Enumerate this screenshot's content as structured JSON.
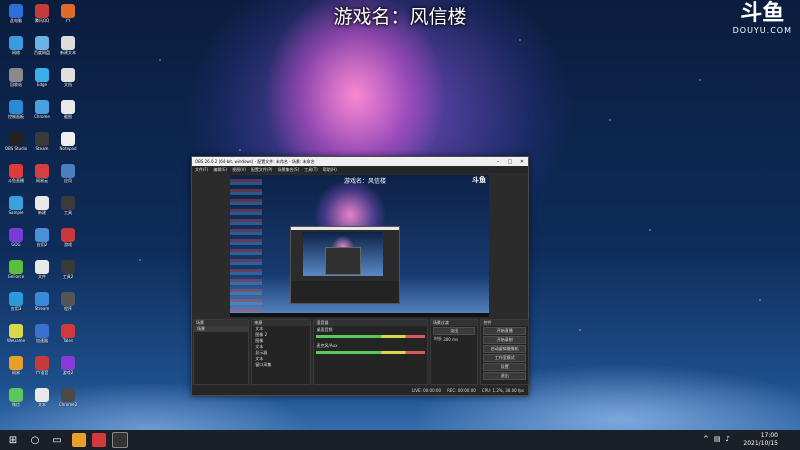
{
  "overlay": {
    "title": "游戏名：风信楼"
  },
  "logo": {
    "cn": "斗鱼",
    "en": "DOUYU.COM"
  },
  "desktop": {
    "icons": [
      {
        "c": "#2d6fd4",
        "label": "此电脑"
      },
      {
        "c": "#c23c3c",
        "label": "腾讯QQ"
      },
      {
        "c": "#e06a2a",
        "label": "YY"
      },
      {
        "c": "#3b9be0",
        "label": "网络"
      },
      {
        "c": "#6bb2e6",
        "label": "百度网盘"
      },
      {
        "c": "#dcdcdc",
        "label": "新建文本"
      },
      {
        "c": "#8a8a8a",
        "label": "回收站"
      },
      {
        "c": "#3bb0e8",
        "label": "Edge"
      },
      {
        "c": "#e0e0e0",
        "label": "文档"
      },
      {
        "c": "#2a8ad8",
        "label": "控制面板"
      },
      {
        "c": "#4aa0e0",
        "label": "Chrome"
      },
      {
        "c": "#e8e8e8",
        "label": "截图"
      },
      {
        "c": "#222",
        "label": "OBS Studio"
      },
      {
        "c": "#3a3a3a",
        "label": "Steam"
      },
      {
        "c": "#f0f0f0",
        "label": "Notepad"
      },
      {
        "c": "#e23a3a",
        "label": "斗鱼直播"
      },
      {
        "c": "#d44040",
        "label": "网易云"
      },
      {
        "c": "#4a80c0",
        "label": "应用"
      },
      {
        "c": "#3aa0e0",
        "label": "Sample"
      },
      {
        "c": "#e8e8e8",
        "label": "新建"
      },
      {
        "c": "#3b3b3b",
        "label": "工具"
      },
      {
        "c": "#7a3ad8",
        "label": "GOG"
      },
      {
        "c": "#4a90d8",
        "label": "应用2"
      },
      {
        "c": "#c83a3a",
        "label": "游戏"
      },
      {
        "c": "#5abf3a",
        "label": "GeForce"
      },
      {
        "c": "#e8e8e8",
        "label": "文件"
      },
      {
        "c": "#3a3a3a",
        "label": "工具2"
      },
      {
        "c": "#2a9ad8",
        "label": "应用3"
      },
      {
        "c": "#3a8ad8",
        "label": "Stream"
      },
      {
        "c": "#555",
        "label": "程序"
      },
      {
        "c": "#d8d84a",
        "label": "WeGame"
      },
      {
        "c": "#3a70d0",
        "label": "加速器"
      },
      {
        "c": "#d03a3a",
        "label": "Tales"
      },
      {
        "c": "#e8a02a",
        "label": "网易"
      },
      {
        "c": "#c83a3a",
        "label": "YY语音"
      },
      {
        "c": "#8a3ad8",
        "label": "游戏2"
      },
      {
        "c": "#5ac85a",
        "label": "微信"
      },
      {
        "c": "#e8e8e8",
        "label": "文本"
      },
      {
        "c": "#4a4a4a",
        "label": "Chrome2"
      }
    ]
  },
  "obs": {
    "title": "OBS 26.0.2 (64-bit, windows) - 配置文件: 未命名 - 场景: 未命名",
    "menu": [
      "文件(F)",
      "编辑(E)",
      "视图(V)",
      "配置文件(P)",
      "场景集合(S)",
      "工具(T)",
      "帮助(H)"
    ],
    "preview_title": "游戏名：风信楼",
    "preview_logo": "斗鱼",
    "docks": {
      "scenes": {
        "header": "场景",
        "items": [
          "场景"
        ]
      },
      "sources": {
        "header": "来源",
        "items": [
          "文本",
          "图像 2",
          "图像",
          "文本",
          "显示器",
          "文本",
          "窗口采集"
        ]
      },
      "mixer": {
        "header": "混音器",
        "rows": [
          "桌面音频",
          "麦克风/Aux"
        ]
      },
      "transitions": {
        "header": "场景过渡",
        "type": "淡出",
        "duration_label": "时长",
        "duration": "300 ms"
      },
      "controls": {
        "header": "控件",
        "buttons": [
          "开始直播",
          "开始录制",
          "启动虚拟摄像机",
          "工作室模式",
          "设置",
          "退出"
        ]
      }
    },
    "status": [
      "LIVE: 00:00:00",
      "REC: 00:00:00",
      "CPU: 1.2%, 30.00 fps"
    ]
  },
  "taskbar": {
    "time": "17:00",
    "date": "2021/10/15"
  },
  "colors": {
    "obs_bg": "#2b2b2b",
    "taskbar": "#1b1f27",
    "accent": "#d8d84a"
  }
}
